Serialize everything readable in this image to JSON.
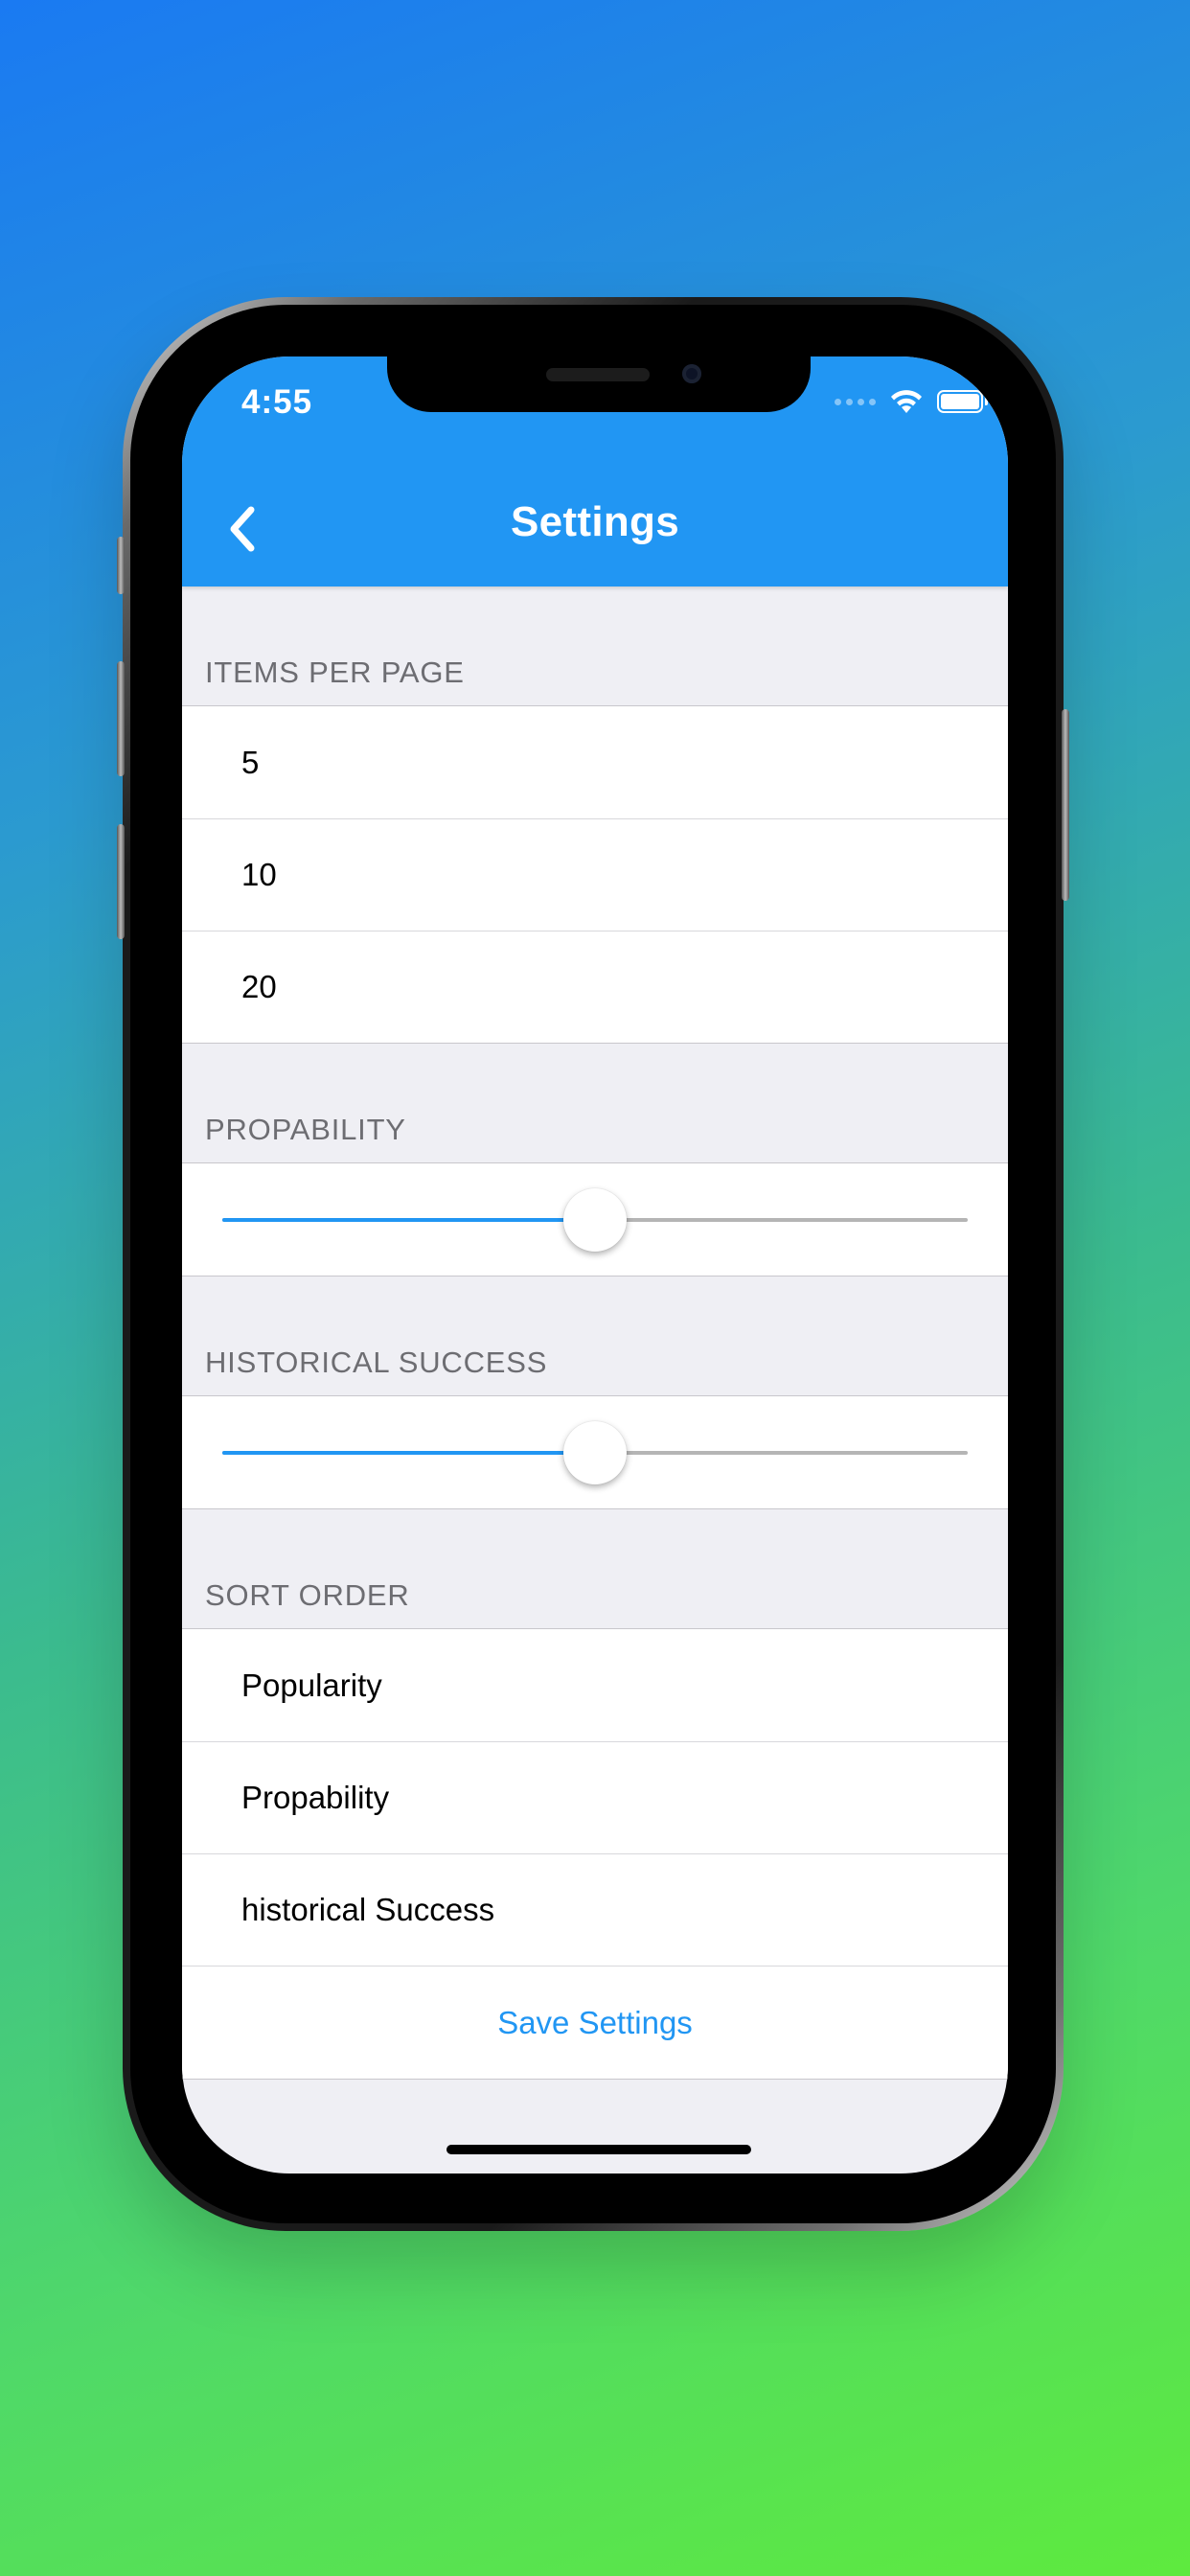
{
  "status_bar": {
    "time": "4:55"
  },
  "navbar": {
    "title": "Settings",
    "back_icon": "chevron-left-icon",
    "color": "#2196f3"
  },
  "sections": {
    "items_per_page": {
      "header": "ITEMS PER PAGE",
      "options": [
        "5",
        "10",
        "20"
      ]
    },
    "probability": {
      "header": "PROPABILITY",
      "value": 0.5
    },
    "historical_success": {
      "header": "HISTORICAL SUCCESS",
      "value": 0.5
    },
    "sort_order": {
      "header": "SORT ORDER",
      "options": [
        "Popularity",
        "Propability",
        "historical Success"
      ]
    }
  },
  "save_button": {
    "label": "Save Settings"
  }
}
